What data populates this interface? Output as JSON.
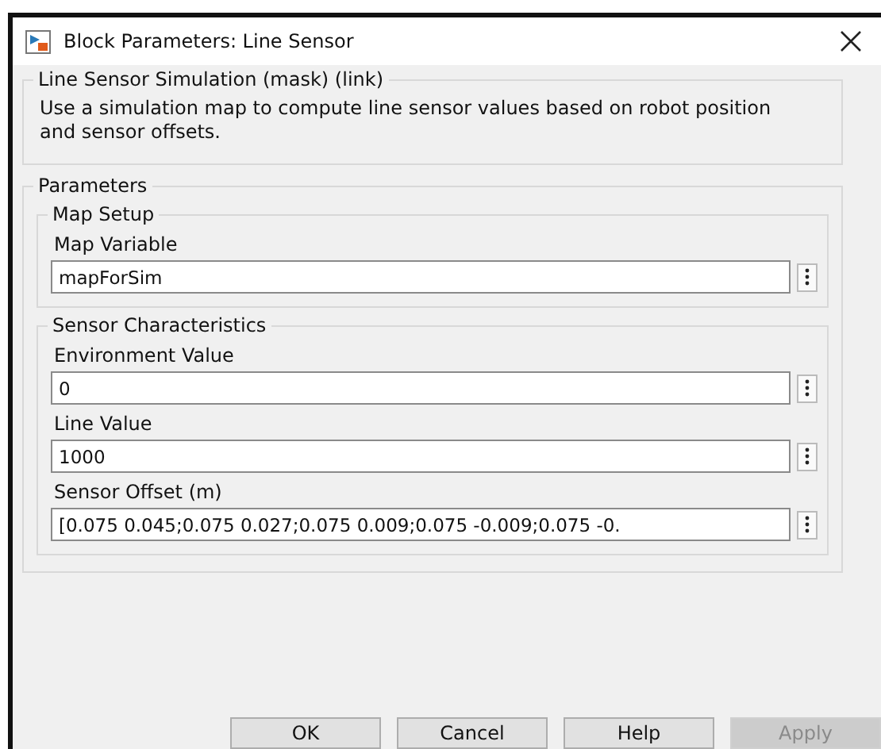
{
  "window": {
    "title": "Block Parameters: Line Sensor"
  },
  "mask": {
    "title": "Line Sensor Simulation (mask) (link)",
    "description": "Use a simulation map to compute line sensor values based on robot position and sensor offsets."
  },
  "parameters": {
    "title": "Parameters",
    "groups": [
      {
        "title": "Map Setup",
        "fields": [
          {
            "label": "Map Variable",
            "value": "mapForSim"
          }
        ]
      },
      {
        "title": "Sensor Characteristics",
        "fields": [
          {
            "label": "Environment Value",
            "value": "0"
          },
          {
            "label": "Line Value",
            "value": "1000"
          },
          {
            "label": "Sensor Offset (m)",
            "value": "[0.075 0.045;0.075 0.027;0.075 0.009;0.075 -0.009;0.075 -0."
          }
        ]
      }
    ]
  },
  "buttons": [
    {
      "label": "OK",
      "disabled": false
    },
    {
      "label": "Cancel",
      "disabled": false
    },
    {
      "label": "Help",
      "disabled": false
    },
    {
      "label": "Apply",
      "disabled": true
    }
  ]
}
